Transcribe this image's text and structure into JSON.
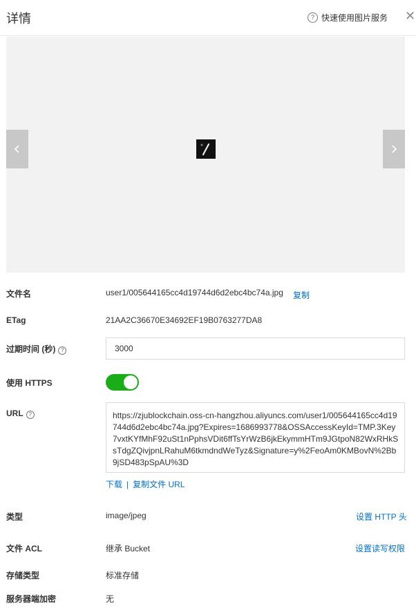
{
  "header": {
    "title": "详情",
    "help_link": "快速使用图片服务",
    "help_icon": "?",
    "close_icon": "✕"
  },
  "preview": {
    "prev_icon": "chevron-left-icon",
    "next_icon": "chevron-right-icon"
  },
  "details": {
    "filename_label": "文件名",
    "filename_value": "user1/005644165cc4d19744d6d2ebc4bc74a.jpg",
    "copy_label": "复制",
    "etag_label": "ETag",
    "etag_value": "21AA2C36670E34692EF19B0763277DA8",
    "expire_label": "过期时间 (秒)",
    "expire_value": "3000",
    "https_label": "使用 HTTPS",
    "https_enabled": true,
    "url_label": "URL",
    "url_value": "https://zjublockchain.oss-cn-hangzhou.aliyuncs.com/user1/005644165cc4d19744d6d2ebc4bc74a.jpg?Expires=1686993778&OSSAccessKeyId=TMP.3Key7vxtKYfMhF92uSt1nPphsVDit6ffTsYrWzB6jkEkymmHTm9JGtpoN82WxRHkSsTdgZQivjpnLRahuM6tkmdndWeTyz&Signature=y%2FeoAm0KMBovN%2Bb9jSD483pSpAU%3D",
    "download_label": "下载",
    "copy_url_label": "复制文件 URL",
    "type_label": "类型",
    "type_value": "image/jpeg",
    "set_http_header": "设置 HTTP 头",
    "acl_label": "文件 ACL",
    "acl_value": "继承 Bucket",
    "set_acl": "设置读写权限",
    "storage_label": "存储类型",
    "storage_value": "标准存储",
    "encryption_label": "服务器端加密",
    "encryption_value": "无"
  },
  "colors": {
    "accent": "#0070cc",
    "switch_on": "#1aad19"
  }
}
